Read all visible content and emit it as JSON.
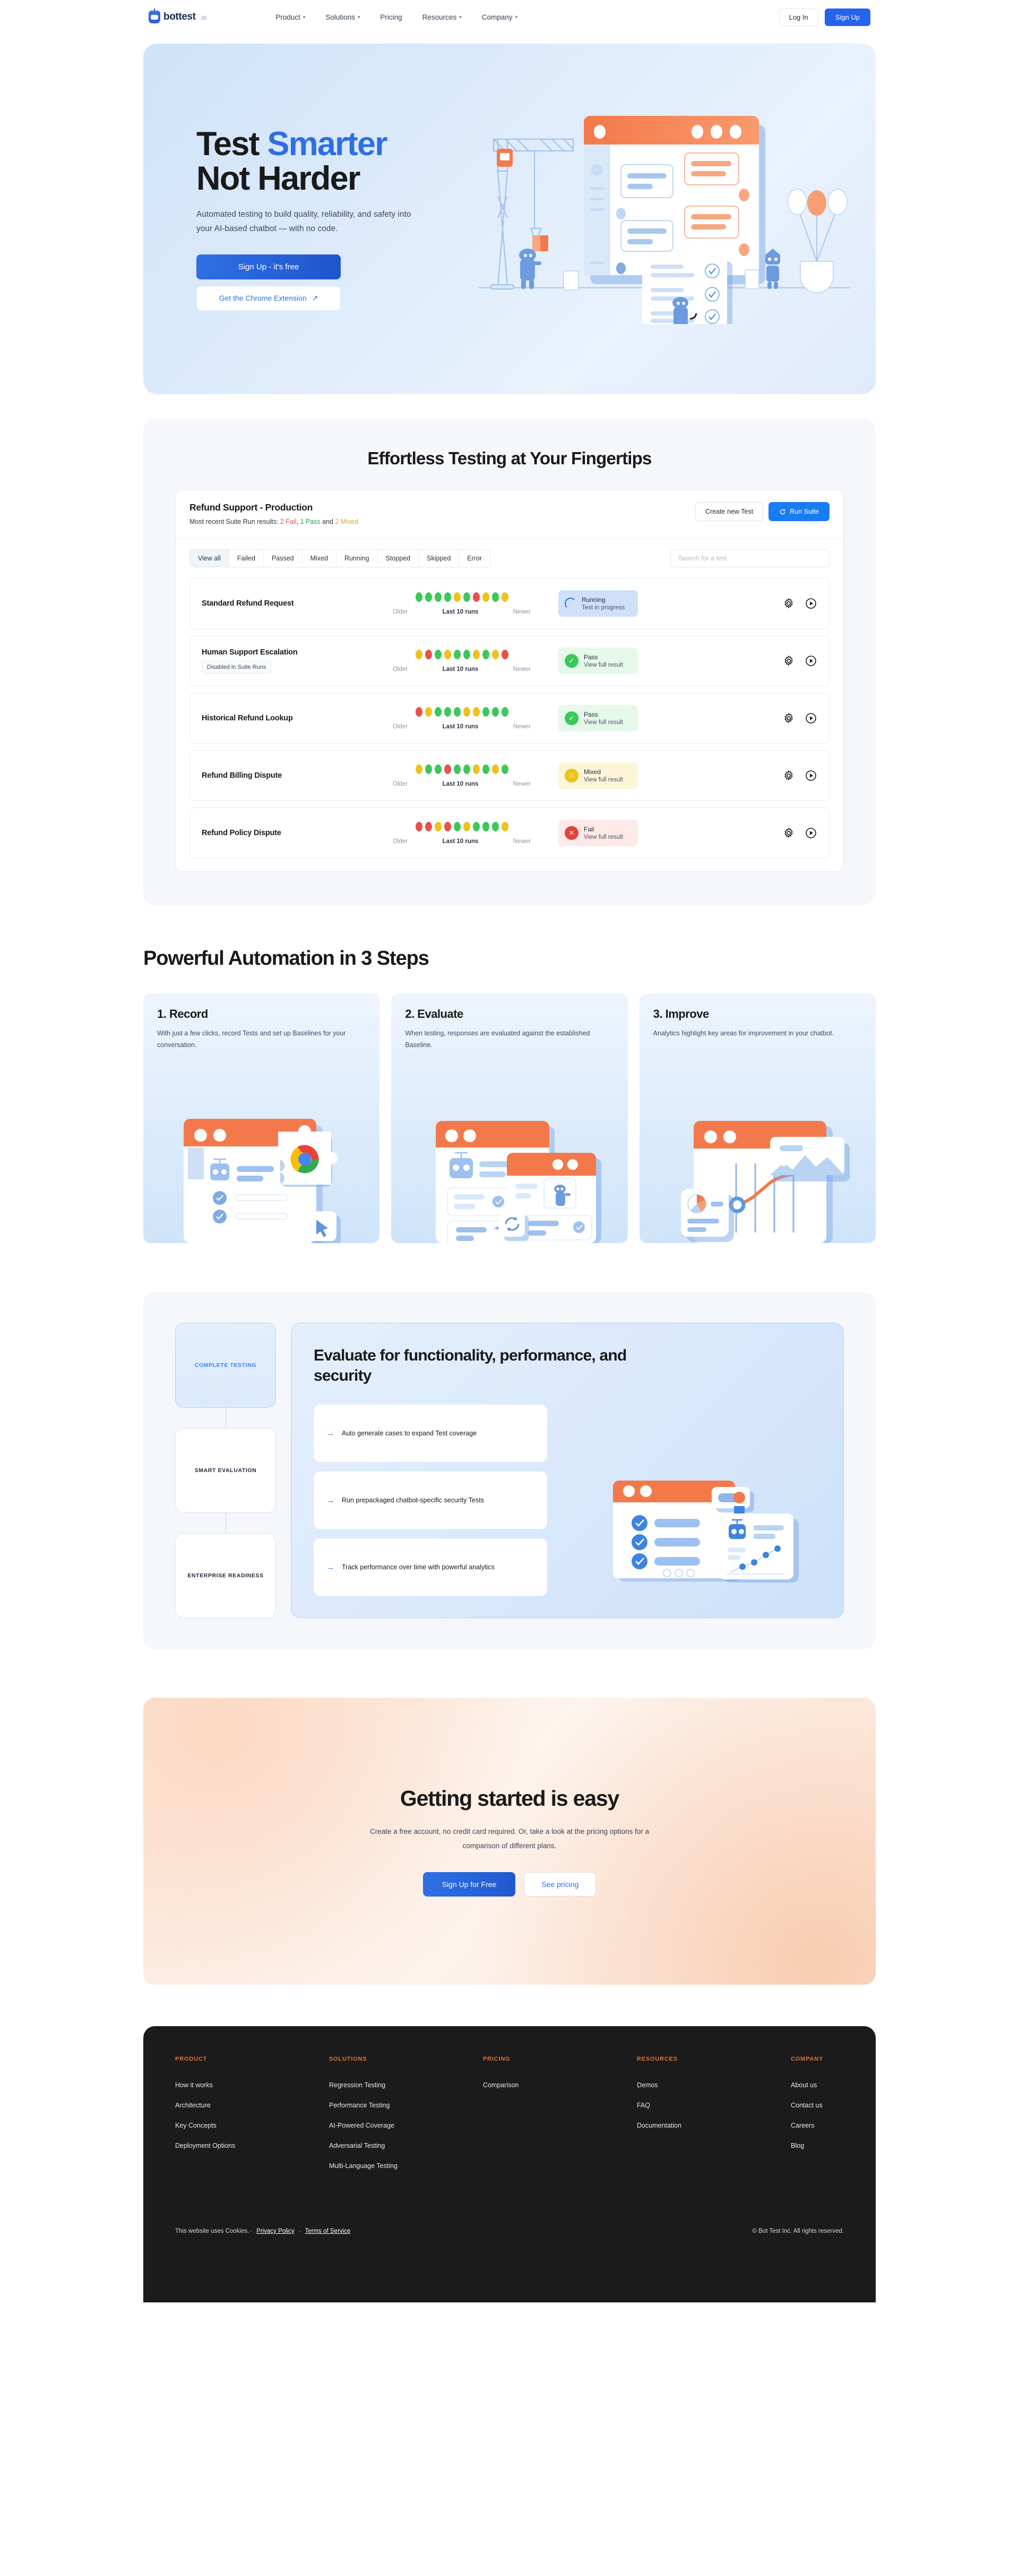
{
  "header": {
    "logo_text": "bottest",
    "logo_suffix": ".ai",
    "nav": [
      {
        "label": "Product",
        "caret": "chevron-down-icon"
      },
      {
        "label": "Solutions",
        "caret": "chevron-down-icon"
      },
      {
        "label": "Pricing",
        "caret": ""
      },
      {
        "label": "Resources",
        "caret": "chevron-down-icon"
      },
      {
        "label": "Company",
        "caret": "chevron-down-icon"
      }
    ],
    "login_label": "Log In",
    "signup_label": "Sign Up"
  },
  "hero": {
    "title_line1_a": "Test ",
    "title_line1_b": "Smarter",
    "title_line2": "Not Harder",
    "subtitle": "Automated testing to build quality, reliability, and safety into your AI-based chatbot — with no code.",
    "primary_cta": "Sign Up - it's free",
    "secondary_cta": "Get the Chrome Extension",
    "secondary_cta_icon": "external-link-icon"
  },
  "effortless": {
    "title": "Effortless Testing at Your Fingertips",
    "suite_name": "Refund Support - Production",
    "suite_results_prefix": "Most recent Suite Run results: ",
    "suite_results_fail": "2 Fail",
    "suite_results_pass": "1 Pass",
    "suite_results_mixed": "2 Mixed",
    "create_label": "Create new Test",
    "run_label": "Run Suite",
    "run_icon": "refresh-icon",
    "filters": [
      "View all",
      "Failed",
      "Passed",
      "Mixed",
      "Running",
      "Stopped",
      "Skipped",
      "Error"
    ],
    "active_filter": "View all",
    "search_placeholder": "Search for a test",
    "dots_label_older": "Older",
    "dots_label_mid": "Last 10 runs",
    "dots_label_newer": "Newer",
    "rows": [
      {
        "name": "Standard Refund Request",
        "badge": "",
        "dots": [
          "pass",
          "pass",
          "pass",
          "pass",
          "mixed",
          "pass",
          "fail",
          "mixed",
          "pass",
          "mixed"
        ],
        "status": "running",
        "status_label": "Running",
        "status_sub": "Test in progress"
      },
      {
        "name": "Human Support Escalation",
        "badge": "Disabled in Suite Runs",
        "dots": [
          "mixed",
          "fail",
          "pass",
          "mixed",
          "pass",
          "pass",
          "mixed",
          "pass",
          "mixed",
          "fail"
        ],
        "status": "pass",
        "status_label": "Pass",
        "status_sub": "View full result"
      },
      {
        "name": "Historical Refund Lookup",
        "badge": "",
        "dots": [
          "fail",
          "mixed",
          "pass",
          "pass",
          "pass",
          "mixed",
          "mixed",
          "pass",
          "pass",
          "pass"
        ],
        "status": "pass",
        "status_label": "Pass",
        "status_sub": "View full result"
      },
      {
        "name": "Refund Billing Dispute",
        "badge": "",
        "dots": [
          "mixed",
          "pass",
          "pass",
          "fail",
          "pass",
          "pass",
          "mixed",
          "pass",
          "mixed",
          "pass"
        ],
        "status": "mixed",
        "status_label": "Mixed",
        "status_sub": "View full result"
      },
      {
        "name": "Refund Policy Dispute",
        "badge": "",
        "dots": [
          "fail",
          "fail",
          "mixed",
          "fail",
          "pass",
          "mixed",
          "pass",
          "pass",
          "pass",
          "mixed"
        ],
        "status": "fail",
        "status_label": "Fail",
        "status_sub": "View full result"
      }
    ]
  },
  "steps": {
    "title": "Powerful Automation in 3 Steps",
    "cards": [
      {
        "heading": "1. Record",
        "body": "With just a few clicks, record Tests and set up Baselines for your conversation."
      },
      {
        "heading": "2. Evaluate",
        "body": "When testing, responses are evaluated against the established Baseline."
      },
      {
        "heading": "3. Improve",
        "body": "Analytics highlight key areas for improvement in your chatbot."
      }
    ]
  },
  "evaluate": {
    "pills": [
      "COMPLETE TESTING",
      "SMART EVALUATION",
      "ENTERPRISE READINESS"
    ],
    "active_pill": "COMPLETE TESTING",
    "heading": "Evaluate for functionality, performance, and security",
    "items": [
      "Auto generate cases to expand Test coverage",
      "Run prepackaged chatbot-specific security Tests",
      "Track performance over time with powerful analytics"
    ]
  },
  "cta": {
    "heading": "Getting started is easy",
    "body": "Create a free account, no credit card required. Or, take a look at the pricing options for a comparison of different plans.",
    "primary": "Sign Up for Free",
    "secondary": "See pricing"
  },
  "footer": {
    "columns": [
      {
        "heading": "PRODUCT",
        "links": [
          "How it works",
          "Architecture",
          "Key Concepts",
          "Deployment Options"
        ]
      },
      {
        "heading": "SOLUTIONS",
        "links": [
          "Regression Testing",
          "Performance Testing",
          "AI-Powered Coverage",
          "Adversarial Testing",
          "Multi-Language Testing"
        ]
      },
      {
        "heading": "PRICING",
        "links": [
          "Comparison"
        ]
      },
      {
        "heading": "RESOURCES",
        "links": [
          "Demos",
          "FAQ",
          "Documentation"
        ]
      },
      {
        "heading": "COMPANY",
        "links": [
          "About us",
          "Contact us",
          "Careers",
          "Blog"
        ]
      }
    ],
    "cookie_text": "This website uses Cookies.",
    "privacy": "Privacy Policy",
    "terms": "Terms of Service",
    "copyright": "© Bot Test Inc. All rights reserved."
  },
  "colors": {
    "brand_blue": "#2f6fe4",
    "accent_orange": "#f47b47",
    "pass_green": "#3cc75a",
    "fail_red": "#e8504b",
    "mixed_yellow": "#eec21a"
  }
}
